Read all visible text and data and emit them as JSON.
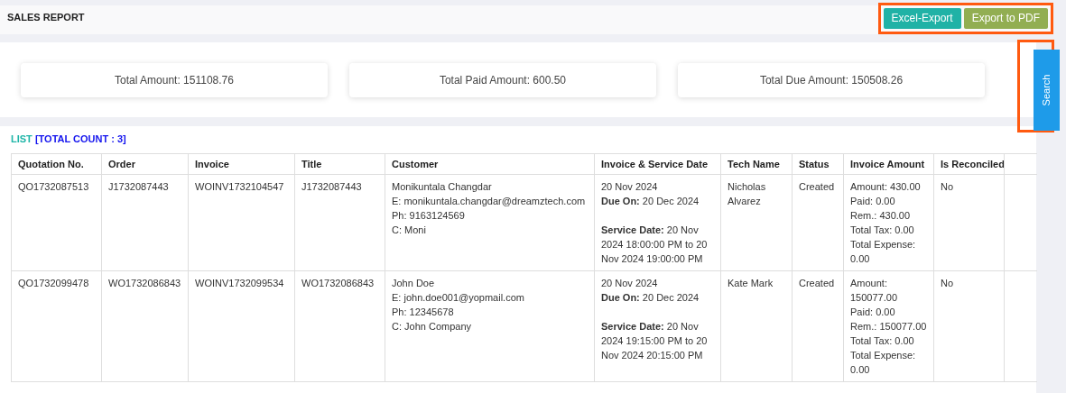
{
  "header": {
    "title": "SALES REPORT",
    "buttons": [
      {
        "label": "Excel-Export",
        "kind": "excel"
      },
      {
        "label": "Export to PDF",
        "kind": "pdf"
      }
    ],
    "highlighted": true
  },
  "search": {
    "label": "Search",
    "highlighted": true
  },
  "totals": [
    {
      "label": "Total Amount: 151108.76"
    },
    {
      "label": "Total Paid Amount: 600.50"
    },
    {
      "label": "Total Due Amount: 150508.26"
    }
  ],
  "list": {
    "title": "LIST",
    "count": "[TOTAL COUNT : 3]"
  },
  "table": {
    "columns": [
      "Quotation No.",
      "Order",
      "Invoice",
      "Title",
      "Customer",
      "Invoice & Service Date",
      "Tech Name",
      "Status",
      "Invoice Amount",
      "Is Reconciled"
    ],
    "rows": [
      {
        "cells": [
          [
            "QO1732087513"
          ],
          [
            "J1732087443"
          ],
          [
            "WOINV1732104547"
          ],
          [
            "J1732087443"
          ],
          [
            "Monikuntala Changdar",
            "E: monikuntala.changdar@dreamztech.com",
            "Ph: 9163124569",
            "C: Moni"
          ],
          [
            "20 Nov 2024",
            "**Due On:** 20 Dec 2024",
            "",
            "**Service Date:** 20 Nov 2024 18:00:00 PM to 20 Nov 2024 19:00:00 PM"
          ],
          [
            "Nicholas Alvarez"
          ],
          [
            "Created"
          ],
          [
            "Amount: 430.00",
            "Paid: 0.00",
            "Rem.: 430.00",
            "Total Tax: 0.00",
            "Total Expense: 0.00"
          ],
          [
            "No"
          ]
        ]
      },
      {
        "cells": [
          [
            "QO1732099478"
          ],
          [
            "WO1732086843"
          ],
          [
            "WOINV1732099534"
          ],
          [
            "WO1732086843"
          ],
          [
            "John Doe",
            "E: john.doe001@yopmail.com",
            "Ph: 12345678",
            "C: John Company"
          ],
          [
            "20 Nov 2024",
            "**Due On:** 20 Dec 2024",
            "",
            "**Service Date:** 20 Nov 2024 19:15:00 PM to 20 Nov 2024 20:15:00 PM"
          ],
          [
            "Kate Mark"
          ],
          [
            "Created"
          ],
          [
            "Amount: 150077.00",
            "Paid: 0.00",
            "Rem.: 150077.00",
            "Total Tax: 0.00",
            "Total Expense: 0.00"
          ],
          [
            "No"
          ]
        ]
      }
    ]
  }
}
